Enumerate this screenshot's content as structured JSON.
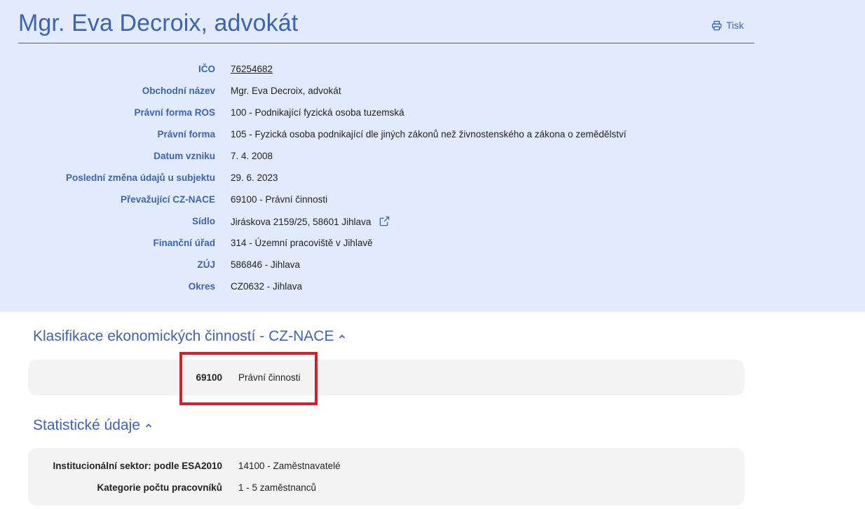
{
  "header": {
    "title": "Mgr. Eva Decroix, advokát",
    "print_label": "Tisk"
  },
  "details": [
    {
      "label": "IČO",
      "value": "76254682",
      "link": true
    },
    {
      "label": "Obchodní název",
      "value": "Mgr. Eva Decroix, advokát"
    },
    {
      "label": "Právní forma ROS",
      "value": "100 - Podnikající fyzická osoba tuzemská"
    },
    {
      "label": "Právní forma",
      "value": "105 - Fyzická osoba podnikající dle jiných zákonů než živnostenského a zákona o zemědělství"
    },
    {
      "label": "Datum vzniku",
      "value": "7. 4. 2008"
    },
    {
      "label": "Poslední změna údajů u subjektu",
      "value": "29. 6. 2023"
    },
    {
      "label": "Převažující CZ-NACE",
      "value": "69100 - Právní činnosti"
    },
    {
      "label": "Sídlo",
      "value": "Jiráskova 2159/25, 58601 Jihlava",
      "external": true
    },
    {
      "label": "Finanční úřad",
      "value": "314 - Územní pracoviště v Jihlavě"
    },
    {
      "label": "ZÚJ",
      "value": "586846 - Jihlava"
    },
    {
      "label": "Okres",
      "value": "CZ0632 - Jihlava"
    }
  ],
  "nace_section": {
    "title": "Klasifikace ekonomických činností - CZ-NACE",
    "items": [
      {
        "code": "69100",
        "name": "Právní činnosti"
      }
    ]
  },
  "stats_section": {
    "title": "Statistické údaje",
    "rows": [
      {
        "label": "Institucionální sektor: podle ESA2010",
        "value": "14100 - Zaměstnavatelé"
      },
      {
        "label": "Kategorie počtu pracovníků",
        "value": "1 - 5 zaměstnanců"
      }
    ]
  },
  "colors": {
    "accent": "#3d63b2",
    "header_bg": "#e1ebfd",
    "panel_bg": "#f3f3f3",
    "highlight": "#d0202c"
  },
  "icons": {
    "print": "printer-icon",
    "external": "external-link-icon",
    "collapse": "chevron-up-icon"
  }
}
